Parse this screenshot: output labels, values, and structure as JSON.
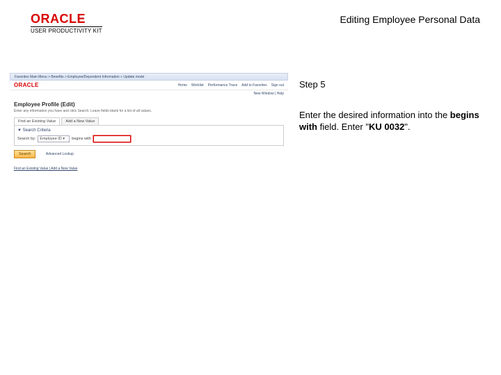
{
  "header": {
    "logo_brand": "ORACLE",
    "logo_sub": "USER PRODUCTIVITY KIT",
    "title": "Editing Employee Personal Data"
  },
  "instructions": {
    "step": "Step 5",
    "line1": "Enter the desired information into the ",
    "bold1": "begins with",
    "line2": " field. Enter \"",
    "bold2": "KU 0032",
    "line3": "\"."
  },
  "shot": {
    "nav1": "Favorites    Main Menu  >  Benefits  >  Employee/Dependent Information  >  Update mode",
    "logo": "ORACLE",
    "menu": [
      "Home",
      "Worklist",
      "Performance Trace",
      "Add to Favorites",
      "Sign out"
    ],
    "sublink": "New Window | Help",
    "title": "Employee Profile (Edit)",
    "desc": "Enter any information you have and click Search. Leave fields blank for a list of all values.",
    "tabs": [
      "Find an Existing Value",
      "Add a New Value"
    ],
    "panel_head": "▼ Search Criteria",
    "search_label": "Search by:",
    "select_value": "Employee ID ▾",
    "begins_label": "begins with",
    "search_btn": "Search",
    "adv": "Advanced Lookup",
    "foot": "Find an Existing Value | Add a New Value"
  }
}
